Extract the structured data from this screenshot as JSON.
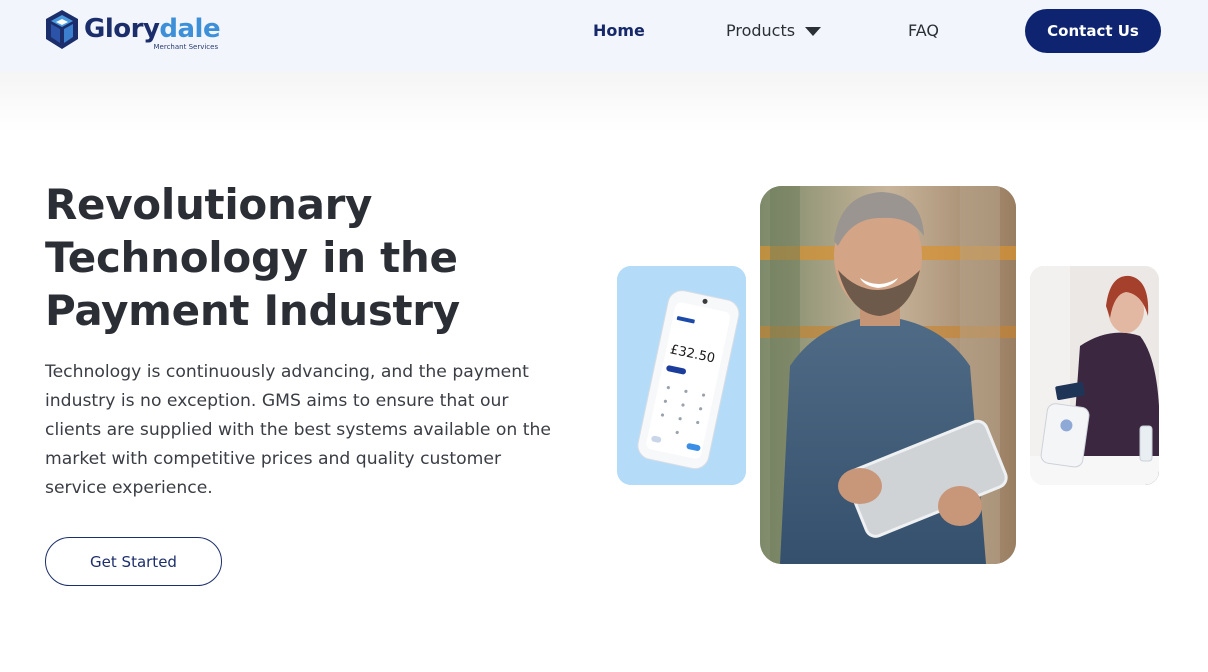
{
  "brand": {
    "name_part1": "Glory",
    "name_part2": "dale",
    "tagline": "Merchant Services",
    "logo_icon": "cube-logo-icon"
  },
  "nav": {
    "home": "Home",
    "products": "Products",
    "faq": "FAQ",
    "contact": "Contact Us"
  },
  "hero": {
    "title_lines": [
      "Revolutionary",
      "Technology in the",
      "Payment Industry"
    ],
    "description": "Technology is continuously advancing, and the payment industry is no exception. GMS aims to ensure that our clients are supplied with the best systems available on the market with competitive prices and quality customer service experience.",
    "cta": "Get Started"
  },
  "images": {
    "terminal": {
      "amount": "£32.50"
    }
  },
  "colors": {
    "primary": "#0e2470",
    "accent": "#3d8fd8",
    "header_bg": "#f2f6fc",
    "text": "#2b2f35"
  }
}
